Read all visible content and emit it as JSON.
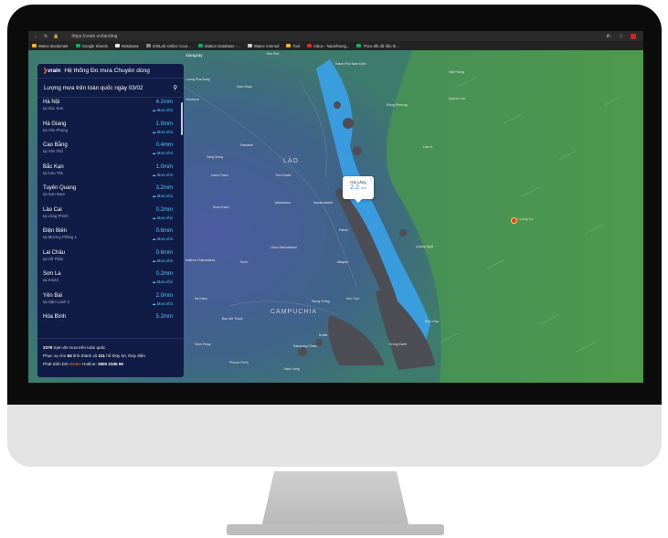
{
  "browser": {
    "url": "https://vrain.vn/landing",
    "bookmarks": [
      "Watec Bookmark",
      "Google Sheets",
      "Metabase",
      "200Lab Online Cour...",
      "Station Database -...",
      "Watec Internal",
      "Tool",
      "Inbox - haianhtong...",
      "Theo dõi dữ liệu th..."
    ]
  },
  "panel": {
    "logo": "vrain",
    "title": "Hệ thống Đo mưa Chuyên dùng",
    "subtitle": "Lượng mưa trên toàn quốc ngày 03/02",
    "stations": [
      {
        "province": "Hà Nội",
        "location": "tại Sóc Sơn",
        "amount": "4.2mm",
        "level": "Mưa nhỏ"
      },
      {
        "province": "Hà Giang",
        "location": "tại Yên Phong",
        "amount": "1.0mm",
        "level": "Mưa nhỏ"
      },
      {
        "province": "Cao Bằng",
        "location": "tại Yên Thổ",
        "amount": "0.4mm",
        "level": "Mưa nhỏ"
      },
      {
        "province": "Bắc Kạn",
        "location": "tại Cao Tân",
        "amount": "1.0mm",
        "level": "Mưa nhỏ"
      },
      {
        "province": "Tuyên Quang",
        "location": "tại Sơn Nam",
        "amount": "3.2mm",
        "level": "Mưa nhỏ"
      },
      {
        "province": "Lào Cai",
        "location": "tại Lũng Phình",
        "amount": "0.2mm",
        "level": "Mưa nhỏ"
      },
      {
        "province": "Điện Biên",
        "location": "tại Mường Phăng 1",
        "amount": "0.6mm",
        "level": "Mưa nhỏ"
      },
      {
        "province": "Lai Châu",
        "location": "tại Hồ Thầu",
        "amount": "0.6mm",
        "level": "Mưa nhỏ"
      },
      {
        "province": "Sơn La",
        "location": "tại Km22",
        "amount": "0.2mm",
        "level": "Mưa nhỏ"
      },
      {
        "province": "Yên Bái",
        "location": "tại Nậm Lành 2",
        "amount": "2.0mm",
        "level": "Mưa nhỏ"
      },
      {
        "province": "Hòa Bình",
        "location": "tại Hòa Bình",
        "amount": "5.2mm",
        "level": "Mưa nhỏ"
      }
    ],
    "footer": {
      "line1_num": "2376",
      "line1_text": "trạm đo mưa trên toàn quốc",
      "line2_pre": "Phục vụ cho",
      "line2_num1": "63",
      "line2_mid": "tỉnh thành và",
      "line2_num2": "211",
      "line2_post": "hồ thủy lợi, thủy điện",
      "line3_pre": "Phát triển bởi",
      "line3_brand": "Watec",
      "line3_hotline_label": "Hotline:",
      "line3_hotline": "1800 2345 96"
    }
  },
  "popup": {
    "station": "Hải Lăng",
    "value": "2.2",
    "unit": "mm"
  },
  "map_labels": {
    "hoang_sa": "Hoàng Sa",
    "laos": "LÀO",
    "cambodia": "CAMPUCHIA",
    "places": [
      "Xiangxay",
      "Tiện Phủ",
      "Luông Pha Bang",
      "Vientiane",
      "Nam Khao",
      "Thành Phố Nam Định",
      "Hải Phòng",
      "Quỳnh Lưu",
      "Đông Phương",
      "Lâm Á",
      "Paksane",
      "Vang Vieng",
      "Udon Thani",
      "Khon Kaen",
      "Tha Khaek",
      "Mukdahan",
      "Savannakhet",
      "Ubon Ratchathani",
      "Pakse",
      "Attapeu",
      "Quảng Ngãi",
      "Stung Treng",
      "Kratie",
      "Kampong Cham",
      "Phnom Penh",
      "Nam Vang",
      "Biên Hòa",
      "Siem Reap",
      "Nakhon Ratchasima",
      "Surin",
      "Sa Kaeo",
      "Krong Kaeb",
      "Ban Me Thuot",
      "Kon Tum"
    ]
  },
  "colors": {
    "accent": "#5cc6ff",
    "panel_bg": "#101c45",
    "map_green": "#3f8a55",
    "rain": "#3aa5f0",
    "station": "#4d4d55"
  }
}
